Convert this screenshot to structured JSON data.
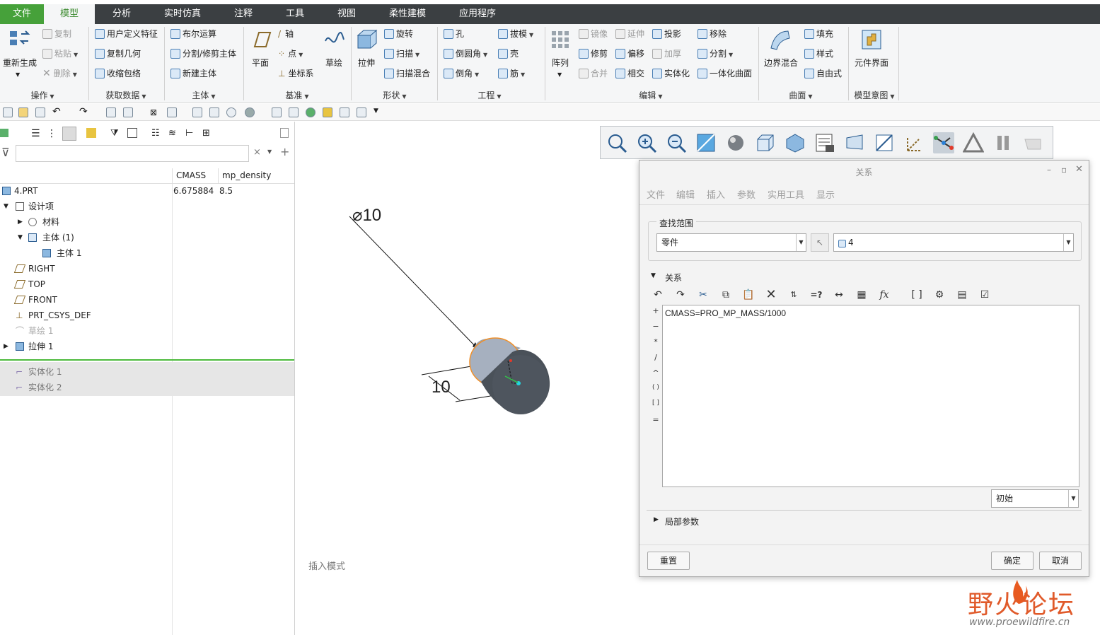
{
  "menubar": {
    "tabs": [
      "文件",
      "模型",
      "分析",
      "实时仿真",
      "注释",
      "工具",
      "视图",
      "柔性建模",
      "应用程序"
    ],
    "active": "模型"
  },
  "ribbon": {
    "regen": "重新生成",
    "ops": {
      "copy": "复制",
      "paste": "粘贴",
      "delete": "删除",
      "label": "操作"
    },
    "get_data": {
      "udf": "用户定义特征",
      "copy_geom": "复制几何",
      "shrinkwrap": "收缩包络",
      "label": "获取数据"
    },
    "body": {
      "boolean": "布尔运算",
      "split_trim": "分割/修剪主体",
      "new_body": "新建主体",
      "label": "主体"
    },
    "datum": {
      "plane": "平面",
      "axis": "轴",
      "point": "点",
      "csys": "坐标系",
      "sketch": "草绘",
      "label": "基准"
    },
    "shape": {
      "extrude": "拉伸",
      "revolve": "旋转",
      "sweep": "扫描",
      "swept_blend": "扫描混合",
      "label": "形状"
    },
    "engineering": {
      "hole": "孔",
      "round": "倒圆角",
      "chamfer": "倒角",
      "draft": "拔模",
      "shell": "壳",
      "rib": "筋",
      "label": "工程"
    },
    "edit": {
      "pattern": "阵列",
      "mirror": "镜像",
      "extend": "延伸",
      "project": "投影",
      "trim": "修剪",
      "offset": "偏移",
      "thicken": "加厚",
      "merge": "合并",
      "intersect": "相交",
      "solidify": "实体化",
      "remove": "移除",
      "split": "分割",
      "unify": "一体化曲面",
      "label": "编辑"
    },
    "surfaces": {
      "boundary": "边界混合",
      "fill": "填充",
      "style": "样式",
      "freestyle": "自由式",
      "label": "曲面"
    },
    "intent": {
      "component_interface": "元件界面",
      "label": "模型意图"
    }
  },
  "tree": {
    "columns": [
      "CMASS",
      "mp_density"
    ],
    "root": {
      "label": "4.PRT",
      "cmass": "6.675884",
      "density": "8.5"
    },
    "items": [
      {
        "label": "设计项"
      },
      {
        "label": "材料"
      },
      {
        "label": "主体 (1)"
      },
      {
        "label": "主体 1"
      },
      {
        "label": "RIGHT"
      },
      {
        "label": "TOP"
      },
      {
        "label": "FRONT"
      },
      {
        "label": "PRT_CSYS_DEF"
      },
      {
        "label": "草绘 1"
      },
      {
        "label": "拉伸 1"
      }
    ],
    "suppressed": [
      {
        "label": "实体化 1"
      },
      {
        "label": "实体化 2"
      }
    ]
  },
  "viewport": {
    "dim_diameter": "⌀10",
    "dim_length": "10",
    "mode_text": "插入模式"
  },
  "dialog": {
    "title": "关系",
    "menus": [
      "文件",
      "编辑",
      "插入",
      "参数",
      "实用工具",
      "显示"
    ],
    "scope_label": "查找范围",
    "scope_type": "零件",
    "scope_value": "4",
    "relations_label": "关系",
    "relation_text": "CMASS=PRO_MP_MASS/1000",
    "side_ops": [
      "+",
      "−",
      "*",
      "/",
      "^",
      "( )",
      "[ ]",
      "="
    ],
    "state": "初始",
    "local_params": "局部参数",
    "btn_reset": "重置",
    "btn_ok": "确定",
    "btn_cancel": "取消"
  },
  "watermark": {
    "title": "野火论坛",
    "url": "www.proewildfire.cn"
  },
  "colors": {
    "menubar_bg": "#3b3f42",
    "file_tab": "#46a13a",
    "accent_green": "#3b8a2e",
    "model_gray": "#5a6570",
    "highlight_orange": "#f0902a"
  }
}
